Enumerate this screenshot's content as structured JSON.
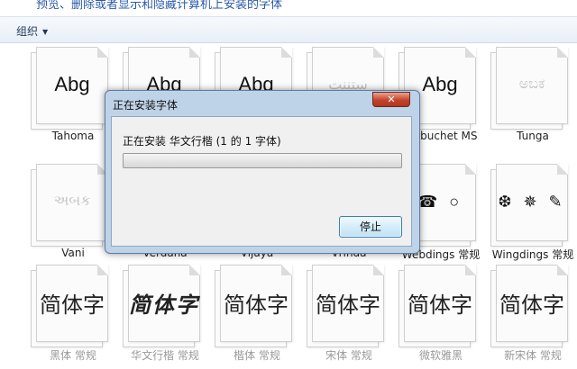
{
  "header": {
    "description_partial": "预览、删除或者显示和隐藏计算机上安装的字体"
  },
  "toolbar": {
    "organize_label": "组织"
  },
  "fonts": [
    {
      "sample": "Abg",
      "label": "Tahoma",
      "style": "normal"
    },
    {
      "sample": "Abg",
      "label": "",
      "style": "normal"
    },
    {
      "sample": "Abg",
      "label": "",
      "style": "normal"
    },
    {
      "sample": "ﺳﺘﻨﻨﺖ",
      "label": "",
      "style": "faded"
    },
    {
      "sample": "Abg",
      "label": "Trebuchet MS",
      "style": "normal"
    },
    {
      "sample": "ಅಬಕ",
      "label": "Tunga",
      "style": "faded"
    },
    {
      "sample": "અબક",
      "label": "Vani",
      "style": "faded"
    },
    {
      "sample": "",
      "label": "Verdana",
      "style": "normal"
    },
    {
      "sample": "",
      "label": "Vijaya",
      "style": "normal"
    },
    {
      "sample": "",
      "label": "Vrinda",
      "style": "normal"
    },
    {
      "sample": "☎ ○",
      "label": "Webdings 常规",
      "style": "dings"
    },
    {
      "sample": "❆ ✵ ✎",
      "label": "Wingdings 常规",
      "style": "dings"
    },
    {
      "sample": "简体字",
      "label": "黑体 常规",
      "style": "cjk"
    },
    {
      "sample": "简体字",
      "label": "华文行楷 常规",
      "style": "cjk-cursive"
    },
    {
      "sample": "简体字",
      "label": "楷体 常规",
      "style": "cjk"
    },
    {
      "sample": "简体字",
      "label": "宋体 常规",
      "style": "cjk"
    },
    {
      "sample": "简体字",
      "label": "微软雅黑",
      "style": "cjk"
    },
    {
      "sample": "简体字",
      "label": "新宋体 常规",
      "style": "cjk"
    }
  ],
  "dialog": {
    "title": "正在安装字体",
    "close_symbol": "✕",
    "status_text": "正在安装 华文行楷 (1 的 1 字体)",
    "progress": 0.0,
    "stop_label": "停止"
  }
}
